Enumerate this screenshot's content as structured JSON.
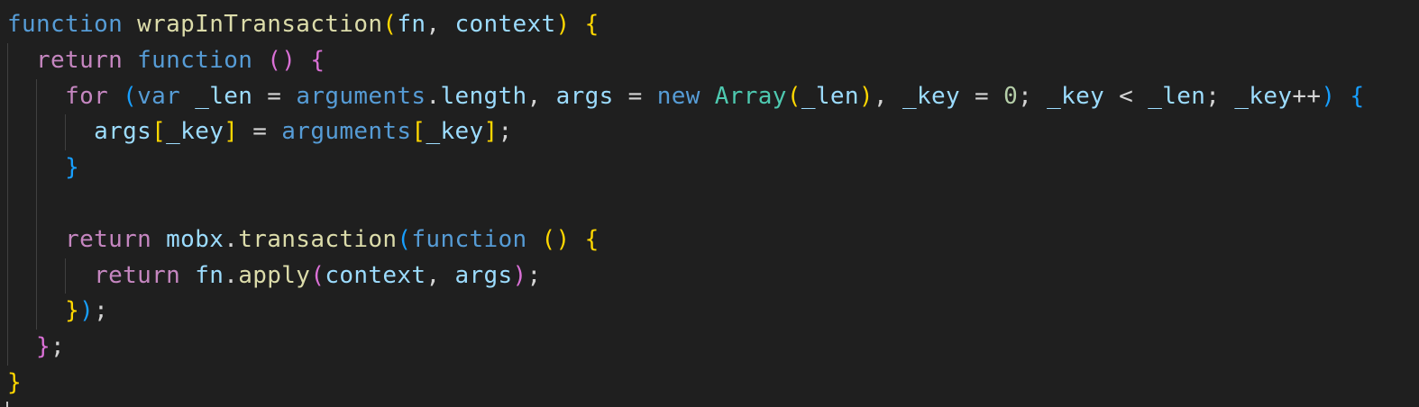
{
  "editor": {
    "theme": "dark",
    "background": "#1f1f1f",
    "token_colors": {
      "keyword": "#569cd6",
      "control_keyword": "#c586c0",
      "function_name": "#dcdcaa",
      "variable": "#9cdcfe",
      "type": "#4ec9b0",
      "number": "#b5cea8",
      "punctuation": "#d4d4d4",
      "bracket_level_1": "#ffd700",
      "bracket_level_2": "#da70d6",
      "bracket_level_3": "#179fff"
    },
    "lines": [
      {
        "indent": 0,
        "tokens": [
          {
            "t": "function",
            "c": "kw-blue"
          },
          {
            "t": " ",
            "c": "plain"
          },
          {
            "t": "wrapInTransaction",
            "c": "fn-name"
          },
          {
            "t": "(",
            "c": "b1"
          },
          {
            "t": "fn",
            "c": "var"
          },
          {
            "t": ", ",
            "c": "plain"
          },
          {
            "t": "context",
            "c": "var"
          },
          {
            "t": ")",
            "c": "b1"
          },
          {
            "t": " ",
            "c": "plain"
          },
          {
            "t": "{",
            "c": "b1"
          }
        ]
      },
      {
        "indent": 1,
        "tokens": [
          {
            "t": "return",
            "c": "kw-ctrl"
          },
          {
            "t": " ",
            "c": "plain"
          },
          {
            "t": "function",
            "c": "kw-blue"
          },
          {
            "t": " ",
            "c": "plain"
          },
          {
            "t": "()",
            "c": "b2"
          },
          {
            "t": " ",
            "c": "plain"
          },
          {
            "t": "{",
            "c": "b2"
          }
        ]
      },
      {
        "indent": 2,
        "tokens": [
          {
            "t": "for",
            "c": "kw-ctrl"
          },
          {
            "t": " ",
            "c": "plain"
          },
          {
            "t": "(",
            "c": "b3"
          },
          {
            "t": "var",
            "c": "kw-blue"
          },
          {
            "t": " ",
            "c": "plain"
          },
          {
            "t": "_len",
            "c": "var"
          },
          {
            "t": " = ",
            "c": "plain"
          },
          {
            "t": "arguments",
            "c": "kw-blue"
          },
          {
            "t": ".",
            "c": "plain"
          },
          {
            "t": "length",
            "c": "var"
          },
          {
            "t": ", ",
            "c": "plain"
          },
          {
            "t": "args",
            "c": "var"
          },
          {
            "t": " = ",
            "c": "plain"
          },
          {
            "t": "new",
            "c": "kw-blue"
          },
          {
            "t": " ",
            "c": "plain"
          },
          {
            "t": "Array",
            "c": "type"
          },
          {
            "t": "(",
            "c": "b1"
          },
          {
            "t": "_len",
            "c": "var"
          },
          {
            "t": ")",
            "c": "b1"
          },
          {
            "t": ", ",
            "c": "plain"
          },
          {
            "t": "_key",
            "c": "var"
          },
          {
            "t": " = ",
            "c": "plain"
          },
          {
            "t": "0",
            "c": "num"
          },
          {
            "t": "; ",
            "c": "plain"
          },
          {
            "t": "_key",
            "c": "var"
          },
          {
            "t": " < ",
            "c": "plain"
          },
          {
            "t": "_len",
            "c": "var"
          },
          {
            "t": "; ",
            "c": "plain"
          },
          {
            "t": "_key",
            "c": "var"
          },
          {
            "t": "++",
            "c": "plain"
          },
          {
            "t": ")",
            "c": "b3"
          },
          {
            "t": " ",
            "c": "plain"
          },
          {
            "t": "{",
            "c": "b3"
          }
        ]
      },
      {
        "indent": 3,
        "tokens": [
          {
            "t": "args",
            "c": "var"
          },
          {
            "t": "[",
            "c": "b1"
          },
          {
            "t": "_key",
            "c": "var"
          },
          {
            "t": "]",
            "c": "b1"
          },
          {
            "t": " = ",
            "c": "plain"
          },
          {
            "t": "arguments",
            "c": "kw-blue"
          },
          {
            "t": "[",
            "c": "b1"
          },
          {
            "t": "_key",
            "c": "var"
          },
          {
            "t": "]",
            "c": "b1"
          },
          {
            "t": ";",
            "c": "plain"
          }
        ]
      },
      {
        "indent": 2,
        "tokens": [
          {
            "t": "}",
            "c": "b3"
          }
        ]
      },
      {
        "indent": 2,
        "tokens": []
      },
      {
        "indent": 2,
        "tokens": [
          {
            "t": "return",
            "c": "kw-ctrl"
          },
          {
            "t": " ",
            "c": "plain"
          },
          {
            "t": "mobx",
            "c": "var"
          },
          {
            "t": ".",
            "c": "plain"
          },
          {
            "t": "transaction",
            "c": "fn-name"
          },
          {
            "t": "(",
            "c": "b3"
          },
          {
            "t": "function",
            "c": "kw-blue"
          },
          {
            "t": " ",
            "c": "plain"
          },
          {
            "t": "()",
            "c": "b1"
          },
          {
            "t": " ",
            "c": "plain"
          },
          {
            "t": "{",
            "c": "b1"
          }
        ]
      },
      {
        "indent": 3,
        "tokens": [
          {
            "t": "return",
            "c": "kw-ctrl"
          },
          {
            "t": " ",
            "c": "plain"
          },
          {
            "t": "fn",
            "c": "var"
          },
          {
            "t": ".",
            "c": "plain"
          },
          {
            "t": "apply",
            "c": "fn-name"
          },
          {
            "t": "(",
            "c": "b2"
          },
          {
            "t": "context",
            "c": "var"
          },
          {
            "t": ", ",
            "c": "plain"
          },
          {
            "t": "args",
            "c": "var"
          },
          {
            "t": ")",
            "c": "b2"
          },
          {
            "t": ";",
            "c": "plain"
          }
        ]
      },
      {
        "indent": 2,
        "tokens": [
          {
            "t": "}",
            "c": "b1"
          },
          {
            "t": ")",
            "c": "b3"
          },
          {
            "t": ";",
            "c": "plain"
          }
        ]
      },
      {
        "indent": 1,
        "tokens": [
          {
            "t": "}",
            "c": "b2"
          },
          {
            "t": ";",
            "c": "plain"
          }
        ]
      },
      {
        "indent": 0,
        "tokens": [
          {
            "t": "}",
            "c": "b1"
          }
        ]
      }
    ]
  }
}
